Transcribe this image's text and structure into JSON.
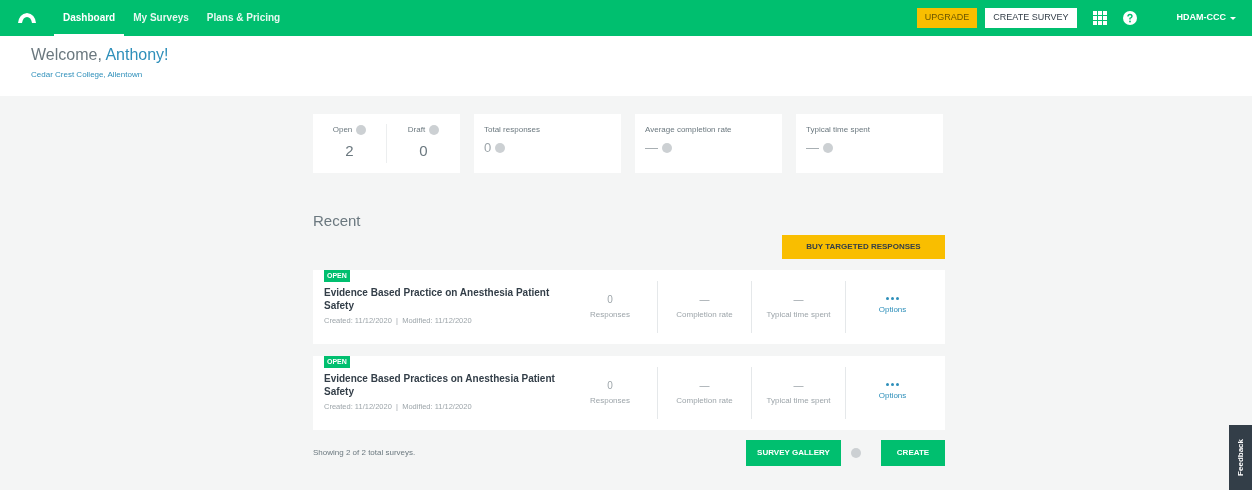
{
  "nav": {
    "items": [
      {
        "label": "Dashboard",
        "selected": true
      },
      {
        "label": "My Surveys",
        "selected": false
      },
      {
        "label": "Plans & Pricing",
        "selected": false
      }
    ],
    "upgrade": "UPGRADE",
    "create_survey": "CREATE SURVEY",
    "account": "HDAM-CCC"
  },
  "welcome": {
    "greeting": "Welcome,",
    "name": "Anthony!",
    "organization": "Cedar Crest College, Allentown"
  },
  "stats": {
    "open": {
      "label": "Open",
      "value": "2"
    },
    "draft": {
      "label": "Draft",
      "value": "0"
    },
    "cards": [
      {
        "label": "Total responses",
        "value": "0"
      },
      {
        "label": "Average completion rate",
        "value": "—"
      },
      {
        "label": "Typical time spent",
        "value": "—"
      }
    ]
  },
  "recent": {
    "title": "Recent",
    "buy_button": "BUY TARGETED RESPONSES",
    "surveys": [
      {
        "status": "OPEN",
        "title": "Evidence Based Practice on Anesthesia Patient Safety",
        "created": "Created: 11/12/2020",
        "modified": "Modified: 11/12/2020",
        "separator": "|",
        "metrics": [
          {
            "value": "0",
            "label": "Responses"
          },
          {
            "value": "—",
            "label": "Completion rate"
          },
          {
            "value": "—",
            "label": "Typical time spent"
          }
        ],
        "options": "Options"
      },
      {
        "status": "OPEN",
        "title": "Evidence Based Practices on Anesthesia Patient Safety",
        "created": "Created: 11/12/2020",
        "modified": "Modified: 11/12/2020",
        "separator": "|",
        "metrics": [
          {
            "value": "0",
            "label": "Responses"
          },
          {
            "value": "—",
            "label": "Completion rate"
          },
          {
            "value": "—",
            "label": "Typical time spent"
          }
        ],
        "options": "Options"
      }
    ]
  },
  "footer": {
    "summary": "Showing 2 of 2 total surveys.",
    "gallery_button": "SURVEY GALLERY",
    "create_button": "CREATE"
  },
  "feedback": "Feedback"
}
